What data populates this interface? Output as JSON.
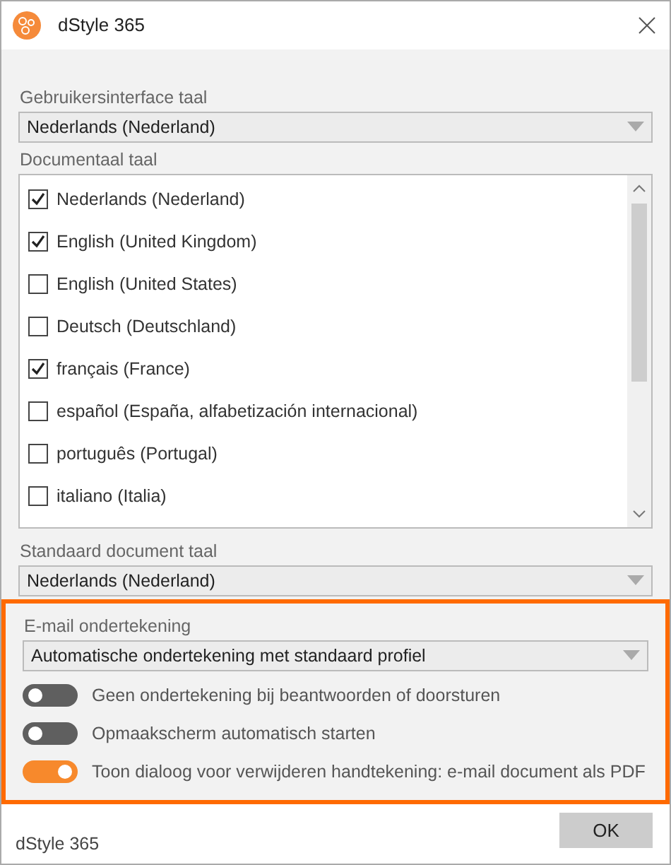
{
  "window": {
    "title": "dStyle 365"
  },
  "ui_language": {
    "label": "Gebruikersinterface taal",
    "value": "Nederlands (Nederland)"
  },
  "document_languages": {
    "label": "Documentaal taal",
    "items": [
      {
        "label": "Nederlands (Nederland)",
        "checked": true
      },
      {
        "label": "English (United Kingdom)",
        "checked": true
      },
      {
        "label": "English (United States)",
        "checked": false
      },
      {
        "label": "Deutsch (Deutschland)",
        "checked": false
      },
      {
        "label": "français (France)",
        "checked": true
      },
      {
        "label": "español (España, alfabetización internacional)",
        "checked": false
      },
      {
        "label": "português (Portugal)",
        "checked": false
      },
      {
        "label": "italiano (Italia)",
        "checked": false
      }
    ]
  },
  "default_language": {
    "label": "Standaard document taal",
    "value": "Nederlands (Nederland)"
  },
  "email_signature": {
    "label": "E-mail ondertekening",
    "value": "Automatische ondertekening met standaard profiel",
    "highlighted": true,
    "toggles": [
      {
        "label": "Geen ondertekening bij beantwoorden of doorsturen",
        "on": false
      },
      {
        "label": "Opmaakscherm automatisch starten",
        "on": false
      },
      {
        "label": "Toon dialoog voor verwijderen handtekening: e-mail document als PDF",
        "on": true
      }
    ]
  },
  "footer": {
    "text": "dStyle 365",
    "button": "OK"
  }
}
